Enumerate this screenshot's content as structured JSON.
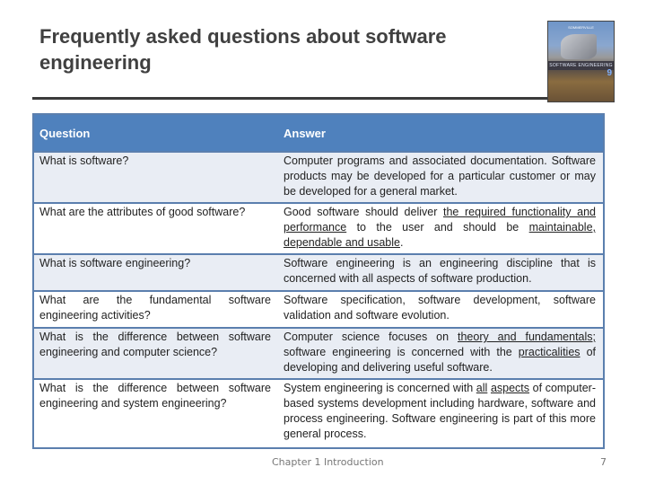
{
  "slide": {
    "title": "Frequently asked questions about software engineering",
    "cover_image": {
      "label": "SOFTWARE ENGINEERING",
      "edition": "9",
      "author": "SOMMERVILLE"
    }
  },
  "table": {
    "headers": {
      "question": "Question",
      "answer": "Answer"
    },
    "rows": [
      {
        "question": "What is software?",
        "answer": [
          {
            "text": "Computer programs and associated documentation. Software products may be developed for a particular customer or may be developed for a general market.",
            "u": false
          }
        ]
      },
      {
        "question": "What are the attributes of good software?",
        "answer": [
          {
            "text": "Good software should deliver ",
            "u": false
          },
          {
            "text": "the required functionality and",
            "u": true
          },
          {
            "text": " ",
            "u": false
          },
          {
            "text": "performance",
            "u": true
          },
          {
            "text": " to the user and should be ",
            "u": false
          },
          {
            "text": "maintainable, dependable and usable",
            "u": true
          },
          {
            "text": ".",
            "u": false
          }
        ]
      },
      {
        "question": "What is software engineering?",
        "answer": [
          {
            "text": "Software engineering is an engineering discipline that is concerned with all aspects of software production.",
            "u": false
          }
        ]
      },
      {
        "question": "What are the fundamental software engineering activities?",
        "answer": [
          {
            "text": "Software specification, software development, software validation and software evolution.",
            "u": false
          }
        ]
      },
      {
        "question": "What is the difference between software engineering and computer science?",
        "answer": [
          {
            "text": "Computer science focuses on ",
            "u": false
          },
          {
            "text": "theory and fundamentals;",
            "u": true
          },
          {
            "text": " software engineering is concerned with the ",
            "u": false
          },
          {
            "text": "practicalities",
            "u": true
          },
          {
            "text": " of developing and delivering useful software.",
            "u": false
          }
        ]
      },
      {
        "question": "What is the difference between software engineering and system engineering?",
        "answer": [
          {
            "text": "System engineering is concerned with ",
            "u": false
          },
          {
            "text": "all",
            "u": true
          },
          {
            "text": " ",
            "u": false
          },
          {
            "text": "aspects",
            "u": true
          },
          {
            "text": " of computer-based systems development including hardware, software and process engineering. Software engineering is part of this more general process.",
            "u": false
          }
        ]
      }
    ]
  },
  "footer": {
    "text": "Chapter 1 Introduction",
    "page_number": "7"
  },
  "colors": {
    "header_bg": "#4f81bd",
    "odd_row_bg": "#e9edf4",
    "even_row_bg": "#ffffff",
    "border": "#5b7fae"
  }
}
